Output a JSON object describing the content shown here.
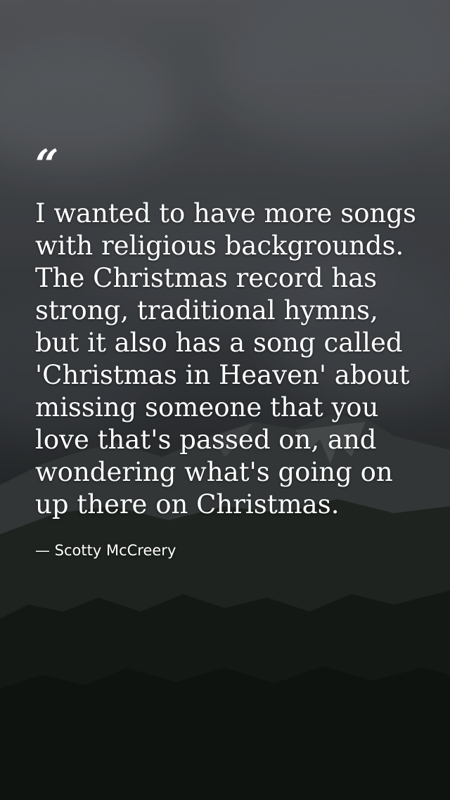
{
  "quote": {
    "mark": "“",
    "text": "I wanted to have more songs with religious backgrounds. The Christmas record has strong, traditional hymns, but it also has a song called 'Christmas in Heaven' about missing someone that you love that's passed on, and wondering what's going on up there on Christmas.",
    "author": "— Scotty McCreery"
  },
  "background": {
    "description_icon": "cloudy-mountain-background",
    "sky_color": "#4f5256",
    "forest_color": "#121612"
  }
}
